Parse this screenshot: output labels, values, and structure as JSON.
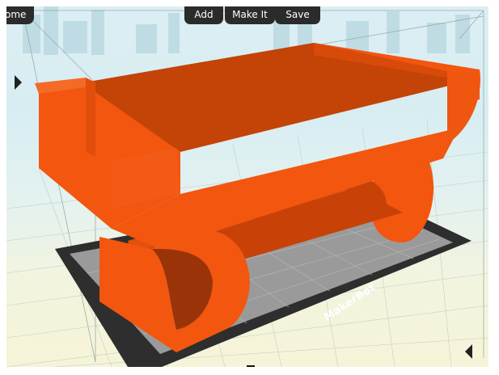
{
  "toolbar": {
    "home_label": "ome",
    "add_label": "Add",
    "make_label": "Make It",
    "save_label": "Save"
  },
  "platform": {
    "brand": "MakerBot"
  },
  "colors": {
    "model_orange": "#f2560f",
    "model_shadow": "#c84208",
    "platform_dark": "#2e2e2e",
    "platform_light": "#9a9a9a",
    "toolbar_bg": "#2b2b2b"
  }
}
